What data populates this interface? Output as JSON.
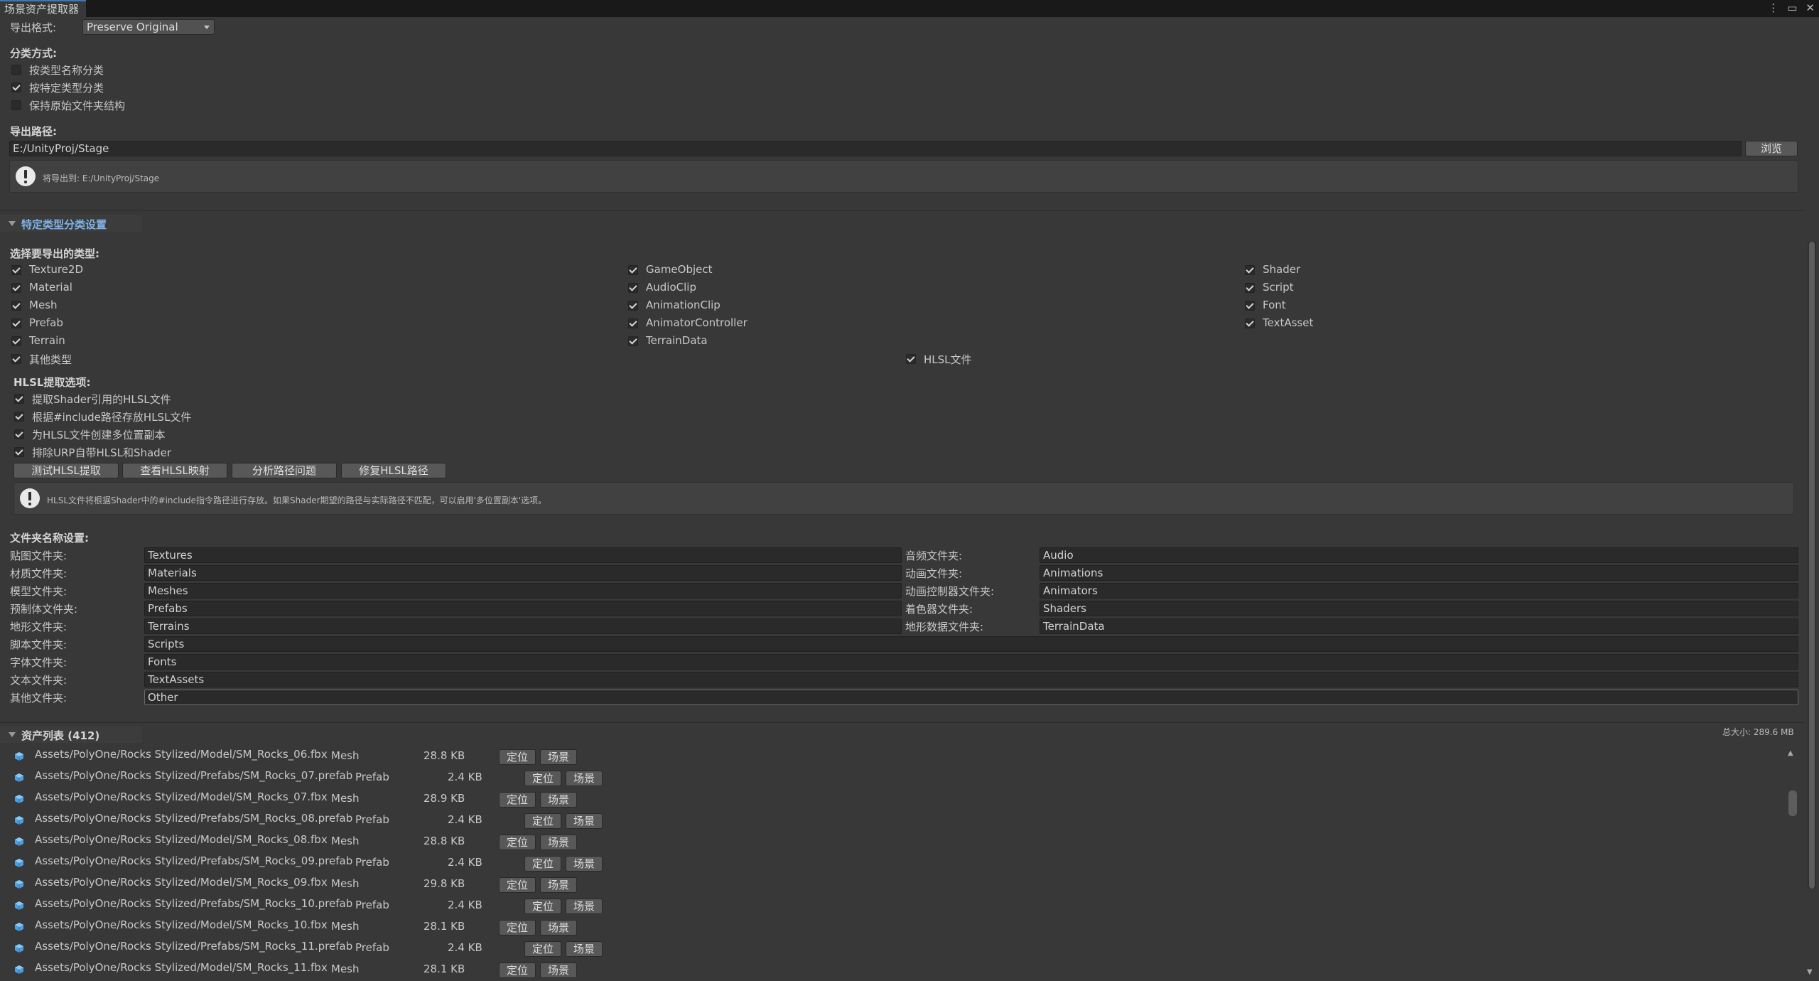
{
  "window": {
    "tab_title": "场景资产提取器"
  },
  "export_format": {
    "label": "导出格式:",
    "value": "Preserve Original"
  },
  "classification": {
    "label": "分类方式:",
    "options": [
      {
        "label": "按类型名称分类",
        "checked": false
      },
      {
        "label": "按特定类型分类",
        "checked": true
      },
      {
        "label": "保持原始文件夹结构",
        "checked": false
      }
    ]
  },
  "export_path": {
    "label": "导出路径:",
    "value": "E:/UnityProj/Stage",
    "browse_label": "浏览",
    "info": "将导出到: E:/UnityProj/Stage"
  },
  "type_settings": {
    "header": "特定类型分类设置",
    "select_label": "选择要导出的类型:",
    "col1": [
      {
        "label": "Texture2D",
        "checked": true
      },
      {
        "label": "Material",
        "checked": true
      },
      {
        "label": "Mesh",
        "checked": true
      },
      {
        "label": "Prefab",
        "checked": true
      },
      {
        "label": "Terrain",
        "checked": true
      },
      {
        "label": "其他类型",
        "checked": true
      }
    ],
    "col2": [
      {
        "label": "GameObject",
        "checked": true
      },
      {
        "label": "AudioClip",
        "checked": true
      },
      {
        "label": "AnimationClip",
        "checked": true
      },
      {
        "label": "AnimatorController",
        "checked": true
      },
      {
        "label": "TerrainData",
        "checked": true
      }
    ],
    "col3": [
      {
        "label": "Shader",
        "checked": true
      },
      {
        "label": "Script",
        "checked": true
      },
      {
        "label": "Font",
        "checked": true
      },
      {
        "label": "TextAsset",
        "checked": true
      }
    ],
    "hlsl_file": {
      "label": "HLSL文件",
      "checked": true
    }
  },
  "hlsl": {
    "label": "HLSL提取选项:",
    "options": [
      {
        "label": "提取Shader引用的HLSL文件",
        "checked": true
      },
      {
        "label": "根据#include路径存放HLSL文件",
        "checked": true
      },
      {
        "label": "为HLSL文件创建多位置副本",
        "checked": true
      },
      {
        "label": "排除URP自带HLSL和Shader",
        "checked": true
      }
    ],
    "buttons": [
      "测试HLSL提取",
      "查看HLSL映射",
      "分析路径问题",
      "修复HLSL路径"
    ],
    "info": "HLSL文件将根据Shader中的#include指令路径进行存放。如果Shader期望的路径与实际路径不匹配，可以启用'多位置副本'选项。"
  },
  "folders": {
    "label": "文件夹名称设置:",
    "left": [
      {
        "label": "贴图文件夹:",
        "value": "Textures"
      },
      {
        "label": "材质文件夹:",
        "value": "Materials"
      },
      {
        "label": "模型文件夹:",
        "value": "Meshes"
      },
      {
        "label": "预制体文件夹:",
        "value": "Prefabs"
      },
      {
        "label": "地形文件夹:",
        "value": "Terrains"
      }
    ],
    "right": [
      {
        "label": "音频文件夹:",
        "value": "Audio"
      },
      {
        "label": "动画文件夹:",
        "value": "Animations"
      },
      {
        "label": "动画控制器文件夹:",
        "value": "Animators"
      },
      {
        "label": "着色器文件夹:",
        "value": "Shaders"
      },
      {
        "label": "地形数据文件夹:",
        "value": "TerrainData"
      }
    ],
    "full": [
      {
        "label": "脚本文件夹:",
        "value": "Scripts"
      },
      {
        "label": "字体文件夹:",
        "value": "Fonts"
      },
      {
        "label": "文本文件夹:",
        "value": "TextAssets"
      },
      {
        "label": "其他文件夹:",
        "value": "Other"
      }
    ]
  },
  "assets": {
    "header": "资产列表 (412)",
    "total": "总大小: 289.6 MB",
    "locate_label": "定位",
    "scene_label": "场景",
    "rows": [
      {
        "path": "Assets/PolyOne/Rocks Stylized/Model/SM_Rocks_06.fbx",
        "type": "Mesh",
        "size": "28.8 KB"
      },
      {
        "path": "Assets/PolyOne/Rocks Stylized/Prefabs/SM_Rocks_07.prefab",
        "type": "Prefab",
        "size": "2.4 KB"
      },
      {
        "path": "Assets/PolyOne/Rocks Stylized/Model/SM_Rocks_07.fbx",
        "type": "Mesh",
        "size": "28.9 KB"
      },
      {
        "path": "Assets/PolyOne/Rocks Stylized/Prefabs/SM_Rocks_08.prefab",
        "type": "Prefab",
        "size": "2.4 KB"
      },
      {
        "path": "Assets/PolyOne/Rocks Stylized/Model/SM_Rocks_08.fbx",
        "type": "Mesh",
        "size": "28.8 KB"
      },
      {
        "path": "Assets/PolyOne/Rocks Stylized/Prefabs/SM_Rocks_09.prefab",
        "type": "Prefab",
        "size": "2.4 KB"
      },
      {
        "path": "Assets/PolyOne/Rocks Stylized/Model/SM_Rocks_09.fbx",
        "type": "Mesh",
        "size": "29.8 KB"
      },
      {
        "path": "Assets/PolyOne/Rocks Stylized/Prefabs/SM_Rocks_10.prefab",
        "type": "Prefab",
        "size": "2.4 KB"
      },
      {
        "path": "Assets/PolyOne/Rocks Stylized/Model/SM_Rocks_10.fbx",
        "type": "Mesh",
        "size": "28.1 KB"
      },
      {
        "path": "Assets/PolyOne/Rocks Stylized/Prefabs/SM_Rocks_11.prefab",
        "type": "Prefab",
        "size": "2.4 KB"
      },
      {
        "path": "Assets/PolyOne/Rocks Stylized/Model/SM_Rocks_11.fbx",
        "type": "Mesh",
        "size": "28.1 KB"
      }
    ]
  },
  "colors": {
    "accent": "#3a79bb",
    "asset_icon": "#4aa0e0",
    "panel": "#383838"
  }
}
